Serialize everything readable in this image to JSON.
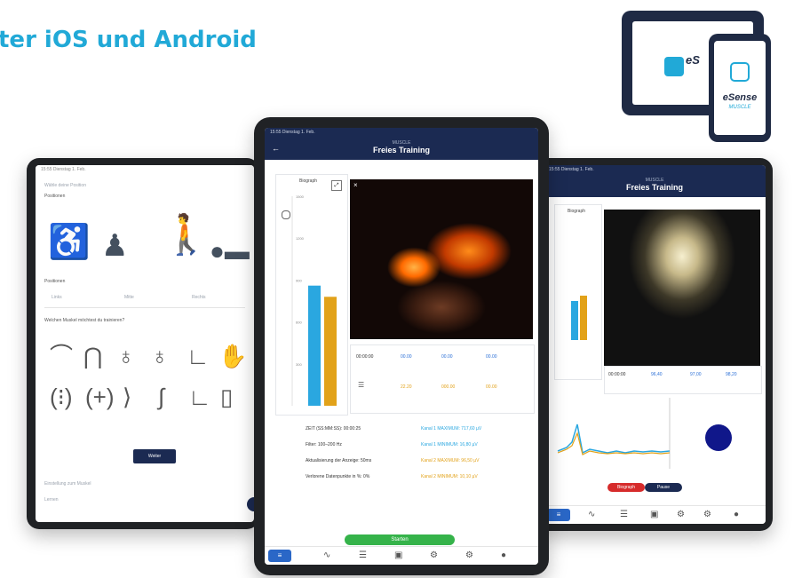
{
  "headline": "ter iOS und Android",
  "logo": {
    "brand_small": "eS",
    "brand": "eSense",
    "sub": "MUSCLE"
  },
  "center": {
    "status_time": "15:55 Dienstag 1. Feb.",
    "nav_small": "MUSCLE",
    "nav_title": "Freies Training",
    "chart_label": "Biograph",
    "y_ticks": [
      "1500",
      "1200",
      "900",
      "600",
      "300"
    ],
    "stats_left": [
      "ZEIT (SS:MM:SS): 00:00:25",
      "Filter: 100–200 Hz",
      "Aktualisierung der Anzeige: 50ms",
      "Verlorene Datenpunkte in %: 0%"
    ],
    "stats_right": [
      "Kanal 1 MAXIMUM: 717,60 µV",
      "Kanal 1 MINIMUM: 16,80 µV",
      "Kanal 2 MAXIMUM: 96,50 µV",
      "Kanal 2 MINIMUM: 10,10 µV"
    ],
    "cells": [
      "00:00:00",
      "00.00",
      "00.00",
      "00.00",
      "22.20",
      "000.00",
      "00.00"
    ],
    "start_label": "Starten",
    "colors": {
      "blue": "#2aa7e0",
      "orange": "#e2a21a",
      "navy": "#1b2a52"
    }
  },
  "chart_data": {
    "type": "bar",
    "categories": [
      "Kanal 1",
      "Kanal 2"
    ],
    "values": [
      860,
      780
    ],
    "ylim": [
      0,
      1500
    ],
    "colors": [
      "#2aa7e0",
      "#e2a21a"
    ]
  },
  "right": {
    "status_time": "15:55 Dienstag 1. Feb.",
    "nav_small": "MUSCLE",
    "nav_title": "Freies Training",
    "panel_label": "Biograph",
    "cells": [
      "00:00:00",
      "96,40",
      "97,00",
      "98,20"
    ],
    "toggle_left": "Biograph",
    "toggle_right": "Pause"
  },
  "left": {
    "status_time": "15:55 Dienstag 1. Feb.",
    "intro": "Wähle deine Position",
    "section1": "Positionen",
    "pos_labels": [
      "Links",
      "Mitte",
      "Rechts"
    ],
    "section2": "Welchen Muskel möchtest du trainieren?",
    "button_label": "Weiter",
    "footer1": "Einstellung zum Muskel",
    "footer2": "Lernen"
  },
  "tabs": [
    "home",
    "graph-icon",
    "list-icon",
    "calendar-icon",
    "settings-icon",
    "gear-icon",
    "person-icon"
  ]
}
